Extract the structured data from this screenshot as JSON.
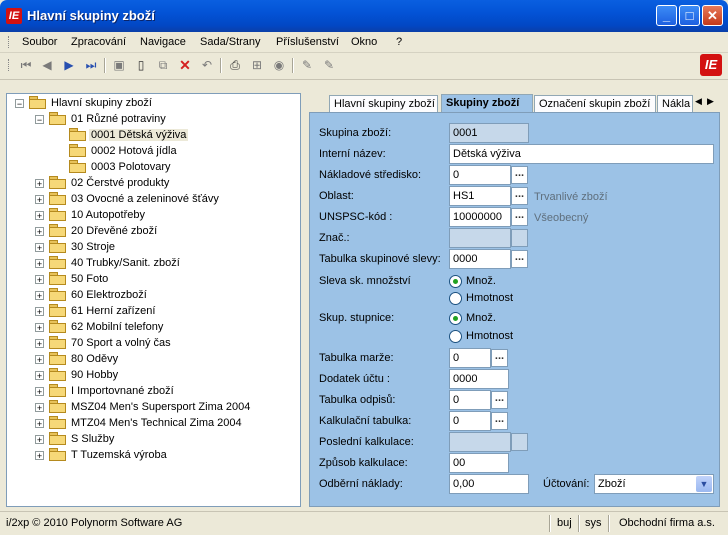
{
  "window": {
    "title": "Hlavní skupiny zboží",
    "app_icon_text": "IE",
    "buttons": {
      "minimize": "_",
      "maximize": "□",
      "close": "✕"
    }
  },
  "menu": [
    "Soubor",
    "Zpracování",
    "Navigace",
    "Sada/Strany",
    "Příslušenství",
    "Okno",
    "?"
  ],
  "toolbar": {
    "brand_icon_text": "IE"
  },
  "tree": {
    "root": "Hlavní skupiny zboží",
    "items": [
      "01  Různé potraviny",
      "0001  Dětská výživa",
      "0002  Hotová jídla",
      "0003  Polotovary",
      "02  Čerstvé produkty",
      "03  Ovocné a zeleninové šťávy",
      "10  Autopotřeby",
      "20  Dřevěné zboží",
      "30  Stroje",
      "40  Trubky/Sanit. zboží",
      "50  Foto",
      "60  Elektrozboží",
      "61  Herní zařízení",
      "62  Mobilní telefony",
      "70  Sport a volný čas",
      "80  Oděvy",
      "90  Hobby",
      "I   Importovnané zboží",
      "MSZ04  Men's Supersport Zima 2004",
      "MTZ04  Men's Technical Zima 2004",
      "S  Služby",
      "T  Tuzemská výroba"
    ]
  },
  "tabs": [
    "Hlavní skupiny zboží",
    "Skupiny zboží",
    "Označení skupin zboží",
    "Nákla"
  ],
  "form": {
    "skupina_label": "Skupina zboží:",
    "skupina_value": "0001",
    "nazev_label": "Interní název:",
    "nazev_value": "Dětská výživa",
    "naklad_label": "Nákladové středisko:",
    "naklad_value": "0",
    "oblast_label": "Oblast:",
    "oblast_value": "HS1",
    "oblast_hint": "Trvanlivé zboží",
    "unspsc_label": "UNSPSC-kód :",
    "unspsc_value": "10000000",
    "unspsc_hint": "Všeobecný",
    "znac_label": "Znač.:",
    "znac_value": "",
    "slevy_label": "Tabulka skupinové slevy:",
    "slevy_value": "0000",
    "sleva_mnoz_label": "Sleva sk. množství",
    "stupnice_label": "Skup. stupnice:",
    "radio_mnoz": "Množ.",
    "radio_hmot": "Hmotnost",
    "marze_label": "Tabulka marže:",
    "marze_value": "0",
    "dodatek_label": "Dodatek účtu  :",
    "dodatek_value": "0000",
    "odpisy_label": "Tabulka odpisů:",
    "odpisy_value": "0",
    "kalk_label": "Kalkulační tabulka:",
    "kalk_value": "0",
    "posledni_label": "Poslední kalkulace:",
    "posledni_value": "",
    "zpusob_label": "Způsob kalkulace:",
    "zpusob_value": "00",
    "odberni_label": "Odběrní náklady:",
    "odberni_value": "0,00",
    "uctovani_label": "Účtování:",
    "uctovani_value": "Zboží",
    "dots": "..."
  },
  "status": {
    "copyright": "i/2xp © 2010 Polynorm Software AG",
    "mode": "buj",
    "user": "sys",
    "company": "Obchodní firma a.s."
  }
}
